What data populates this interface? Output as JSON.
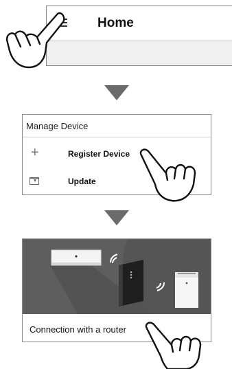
{
  "step1": {
    "menu_icon": "hamburger-menu-icon",
    "title": "Home"
  },
  "step2": {
    "header": "Manage Device",
    "items": [
      {
        "icon": "plus-icon",
        "label": "Register Device"
      },
      {
        "icon": "download-icon",
        "label": "Update"
      }
    ]
  },
  "step3": {
    "illustration": "router-connection-illustration",
    "label": "Connection with a router"
  },
  "colors": {
    "arrow": "#6b6b6b",
    "illustration_bg": "#5e5e5e",
    "border": "#8a8a8a"
  }
}
